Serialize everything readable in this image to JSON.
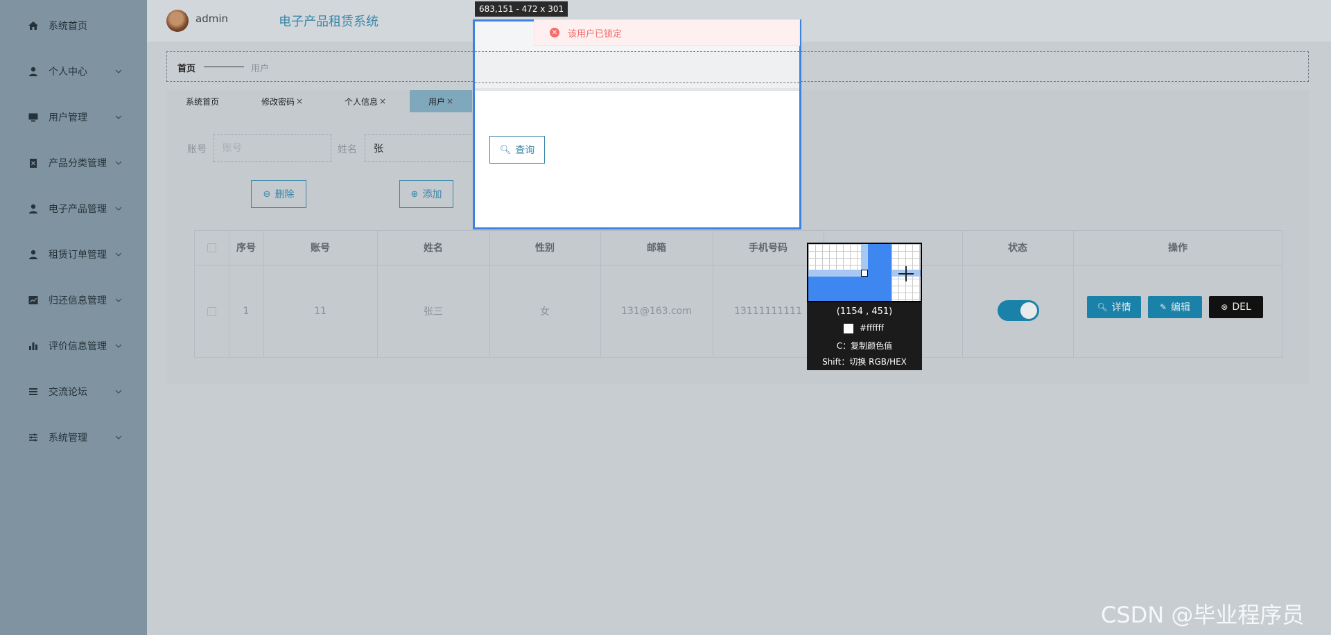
{
  "selection_readout": "683,151 - 472 x 301",
  "toast": {
    "icon": "error-circle-icon",
    "message": "该用户已锁定",
    "color": "#f56c6c"
  },
  "header": {
    "username": "admin",
    "system_title": "电子产品租赁系统"
  },
  "sidebar": {
    "items": [
      {
        "label": "系统首页",
        "icon": "home-icon",
        "has_children": false
      },
      {
        "label": "个人中心",
        "icon": "user-icon",
        "has_children": true
      },
      {
        "label": "用户管理",
        "icon": "monitor-icon",
        "has_children": true
      },
      {
        "label": "产品分类管理",
        "icon": "clipboard-icon",
        "has_children": true
      },
      {
        "label": "电子产品管理",
        "icon": "user-icon",
        "has_children": true
      },
      {
        "label": "租赁订单管理",
        "icon": "user-icon",
        "has_children": true
      },
      {
        "label": "归还信息管理",
        "icon": "line-chart-icon",
        "has_children": true
      },
      {
        "label": "评价信息管理",
        "icon": "bar-chart-icon",
        "has_children": true
      },
      {
        "label": "交流论坛",
        "icon": "list-icon",
        "has_children": true
      },
      {
        "label": "系统管理",
        "icon": "sliders-icon",
        "has_children": true
      }
    ]
  },
  "breadcrumb": {
    "home": "首页",
    "current": "用户"
  },
  "tabs": [
    {
      "label": "系统首页",
      "closable": false,
      "active": false
    },
    {
      "label": "修改密码",
      "closable": true,
      "active": false
    },
    {
      "label": "个人信息",
      "closable": true,
      "active": false
    },
    {
      "label": "用户",
      "closable": true,
      "active": true
    }
  ],
  "tab_close_glyph": "×",
  "search": {
    "account_label": "账号",
    "account_placeholder": "账号",
    "account_value": "",
    "name_label": "姓名",
    "name_value": "张",
    "query_button": "查询"
  },
  "toolbar": {
    "add_button": "添加",
    "delete_button": "删除"
  },
  "table": {
    "columns": [
      "序号",
      "账号",
      "姓名",
      "性别",
      "邮箱",
      "手机号码",
      "状态",
      "操作"
    ],
    "rows": [
      {
        "index": "1",
        "account": "11",
        "name": "张三",
        "gender": "女",
        "email": "131@163.com",
        "phone": "13111111111",
        "status_on": true
      }
    ],
    "actions": {
      "detail": "详情",
      "edit": "编辑",
      "delete": "DEL"
    }
  },
  "color_picker": {
    "coordinates": "(1154 , 451)",
    "hex": "#ffffff",
    "copy_hint": "C：复制颜色值",
    "switch_hint": "Shift：切换 RGB/HEX"
  },
  "watermark": "CSDN @毕业程序员",
  "colors": {
    "accent": "#1a82a8",
    "sidebar": "#7f94a0",
    "selection": "#3e82e0"
  }
}
